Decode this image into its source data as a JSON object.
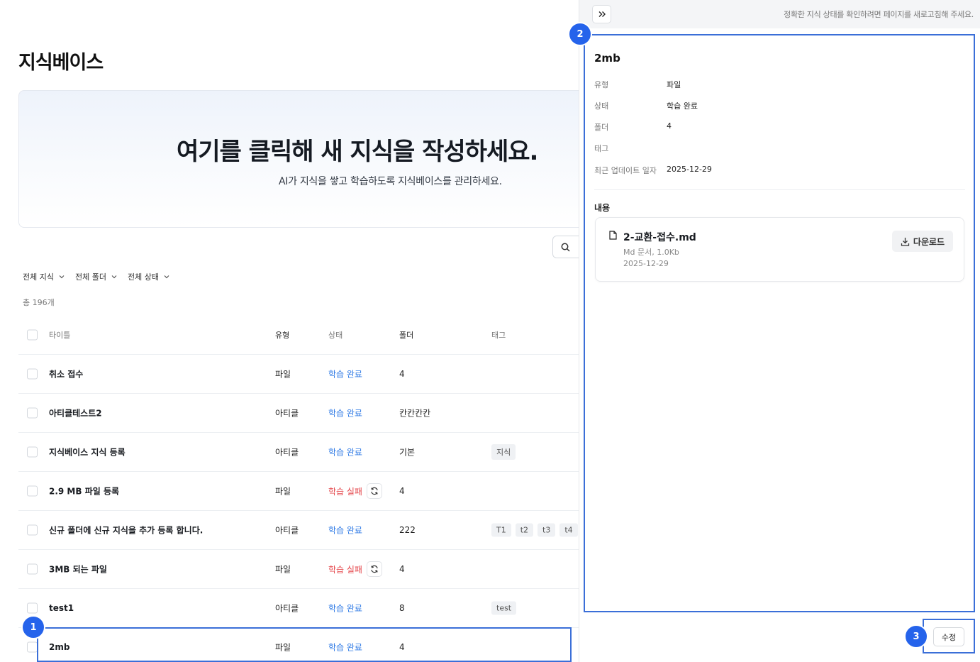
{
  "page": {
    "title": "지식베이스"
  },
  "hero": {
    "title": "여기를 클릭해 새 지식을 작성하세요.",
    "subtitle": "AI가 지식을 쌓고 학습하도록 지식베이스를 관리하세요."
  },
  "filters": [
    {
      "label": "전체 지식"
    },
    {
      "label": "전체 폴더"
    },
    {
      "label": "전체 상태"
    }
  ],
  "total_label": "총 196개",
  "table": {
    "headers": {
      "title": "타이틀",
      "type": "유형",
      "status": "상태",
      "folder": "폴더",
      "tags": "태그"
    },
    "rows": [
      {
        "title": "취소 접수",
        "type": "파일",
        "status": "학습 완료",
        "folder": "4",
        "tags": []
      },
      {
        "title": "아티클테스트2",
        "type": "아티클",
        "status": "학습 완료",
        "folder": "칸칸칸칸",
        "tags": []
      },
      {
        "title": "지식베이스 지식 등록",
        "type": "아티클",
        "status": "학습 완료",
        "folder": "기본",
        "tags": [
          "지식"
        ]
      },
      {
        "title": "2.9 MB 파일 등록",
        "type": "파일",
        "status": "학습 실패",
        "folder": "4",
        "tags": []
      },
      {
        "title": "신규 폴더에 신규 지식을 추가 등록 합니다.",
        "type": "아티클",
        "status": "학습 완료",
        "folder": "222",
        "tags": [
          "T1",
          "t2",
          "t3",
          "t4"
        ]
      },
      {
        "title": "3MB 되는 파일",
        "type": "파일",
        "status": "학습 실패",
        "folder": "4",
        "tags": []
      },
      {
        "title": "test1",
        "type": "아티클",
        "status": "학습 완료",
        "folder": "8",
        "tags": [
          "test"
        ]
      },
      {
        "title": "2mb",
        "type": "파일",
        "status": "학습 완료",
        "folder": "4",
        "tags": []
      }
    ]
  },
  "panel": {
    "refresh_note": "정확한 지식 상태를 확인하려면 페이지를 새로고침해 주세요.",
    "name": "2mb",
    "meta": {
      "type_label": "유형",
      "type_value": "파일",
      "status_label": "상태",
      "status_value": "학습 완료",
      "folder_label": "폴더",
      "folder_value": "4",
      "tag_label": "태그",
      "updated_label": "최근 업데이트 일자",
      "updated_value": "2025-12-29"
    },
    "content_label": "내용",
    "file": {
      "name": "2-교환-접수.md",
      "meta": "Md 문서, 1.0Kb",
      "date": "2025-12-29",
      "download_label": "다운로드"
    },
    "edit_label": "수정"
  },
  "markers": [
    "1",
    "2",
    "3"
  ],
  "colors": {
    "accent": "#2f7ae5",
    "fail": "#e5484d",
    "annotation": "#2563eb"
  }
}
